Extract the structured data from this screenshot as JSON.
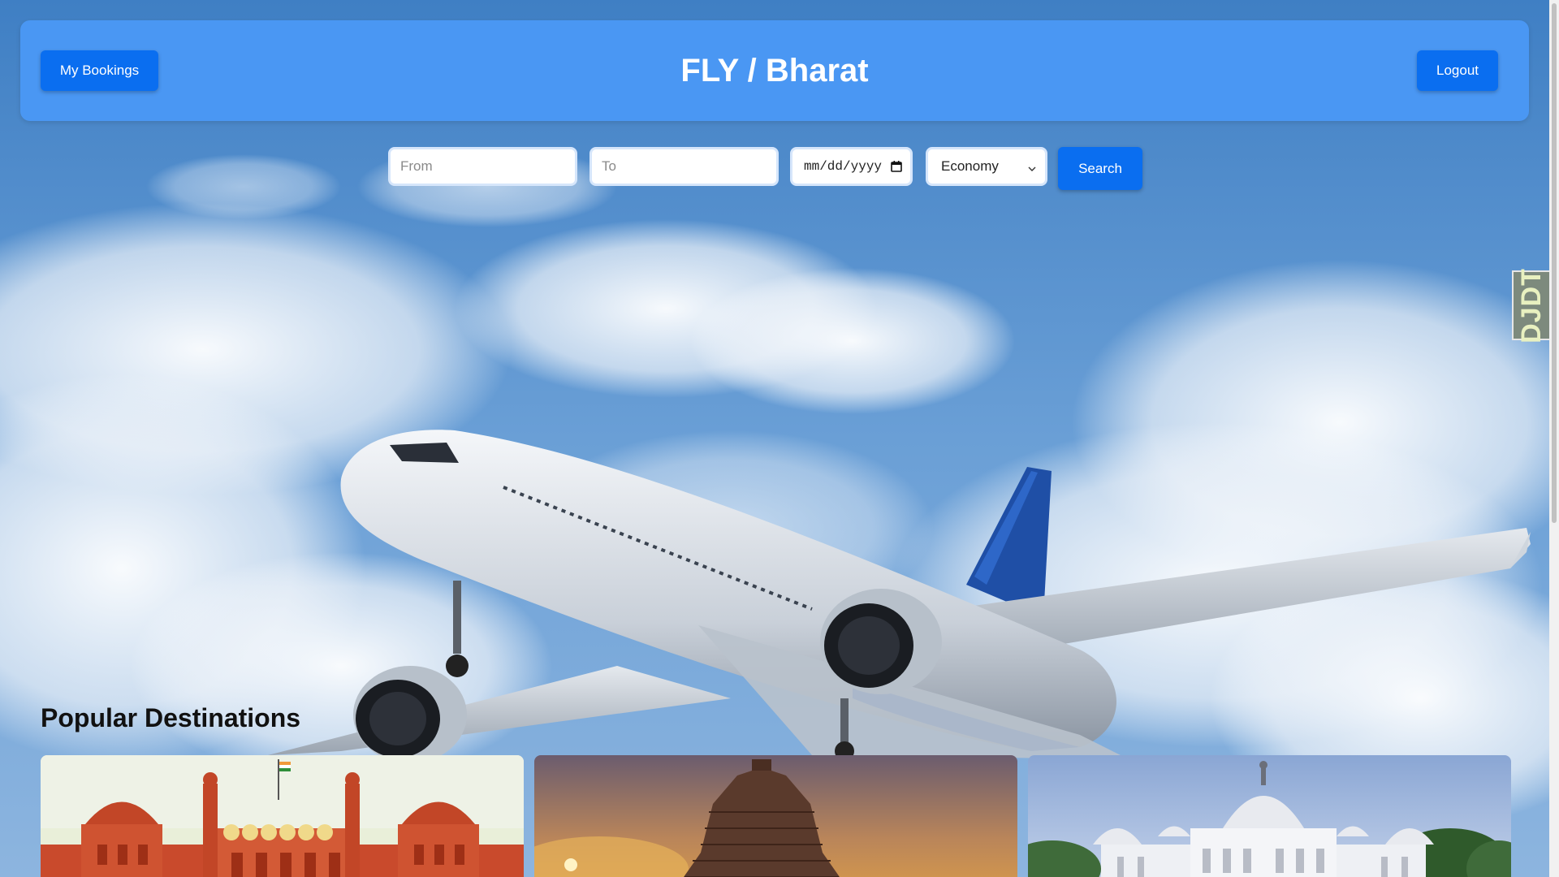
{
  "header": {
    "title": "FLY / Bharat",
    "my_bookings_label": "My Bookings",
    "logout_label": "Logout"
  },
  "search": {
    "from_placeholder": "From",
    "to_placeholder": "To",
    "date_placeholder": "mm/dd/yyyy",
    "class_selected": "Economy",
    "search_label": "Search"
  },
  "side_badge": {
    "text": "DJDT"
  },
  "destinations": {
    "title": "Popular Destinations",
    "cards": [
      {
        "image": "red-fort-photo"
      },
      {
        "image": "sun-temple-photo"
      },
      {
        "image": "victoria-memorial-photo"
      }
    ]
  },
  "colors": {
    "header_bg": "#4a97f3",
    "button_bg": "#0a6ef0",
    "sky": "#4a86c8"
  }
}
